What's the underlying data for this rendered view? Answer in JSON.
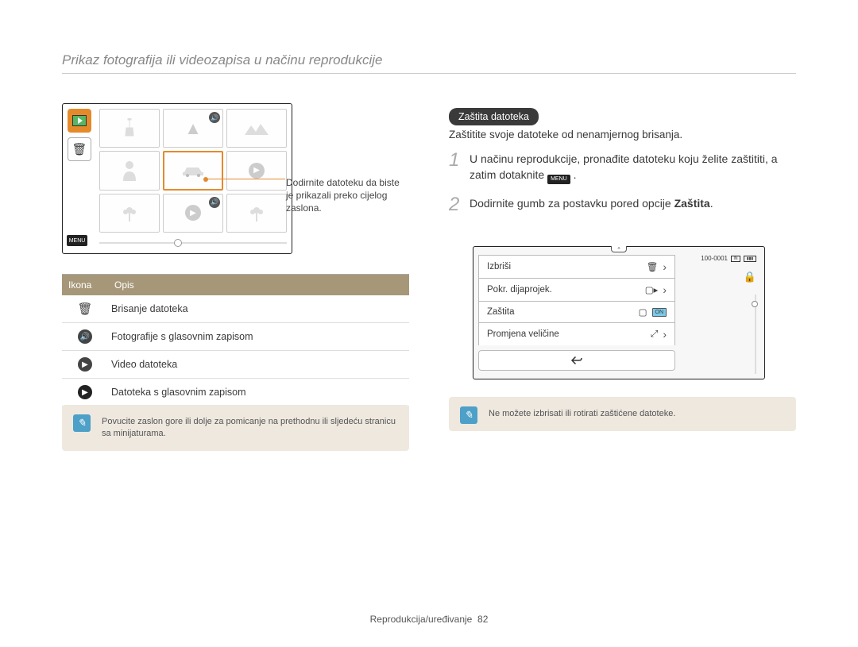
{
  "page": {
    "title": "Prikaz fotografija ili videozapisa u načinu reprodukcije"
  },
  "left": {
    "menu_label": "MENU",
    "callout": "Dodirnite datoteku da biste je prikazali preko cijelog zaslona.",
    "table": {
      "head_icon": "Ikona",
      "head_desc": "Opis",
      "rows": [
        {
          "icon": "trash",
          "desc": "Brisanje datoteka"
        },
        {
          "icon": "audio",
          "desc": "Fotografije s glasovnim zapisom"
        },
        {
          "icon": "play",
          "desc": "Video datoteka"
        },
        {
          "icon": "play-audio",
          "desc": "Datoteka s glasovnim zapisom"
        }
      ]
    },
    "note": "Povucite zaslon gore ili dolje za pomicanje na prethodnu ili sljedeću stranicu sa minijaturama."
  },
  "right": {
    "section_title": "Zaštita datoteka",
    "intro": "Zaštitite svoje datoteke od nenamjernog brisanja.",
    "steps": [
      {
        "n": "1",
        "text_a": "U načinu reprodukcije, pronađite datoteku koju želite zaštititi, a zatim dotaknite ",
        "inline_icon": "MENU",
        "text_b": " ."
      },
      {
        "n": "2",
        "text_a": "Dodirnite gumb za postavku pored opcije ",
        "bold": "Zaštita",
        "text_b": "."
      }
    ],
    "mini": {
      "rows": [
        {
          "label": "Izbriši",
          "icon": "trash"
        },
        {
          "label": "Pokr. dijaprojek.",
          "icon": "slide"
        },
        {
          "label": "Zaštita",
          "icon": "toggle",
          "toggle": "ON"
        },
        {
          "label": "Promjena veličine",
          "icon": "resize"
        }
      ],
      "status_id": "100-0001",
      "status_in": "IN"
    },
    "note": "Ne možete izbrisati ili rotirati zaštićene datoteke."
  },
  "footer": {
    "section": "Reprodukcija/uređivanje",
    "page_no": "82"
  }
}
